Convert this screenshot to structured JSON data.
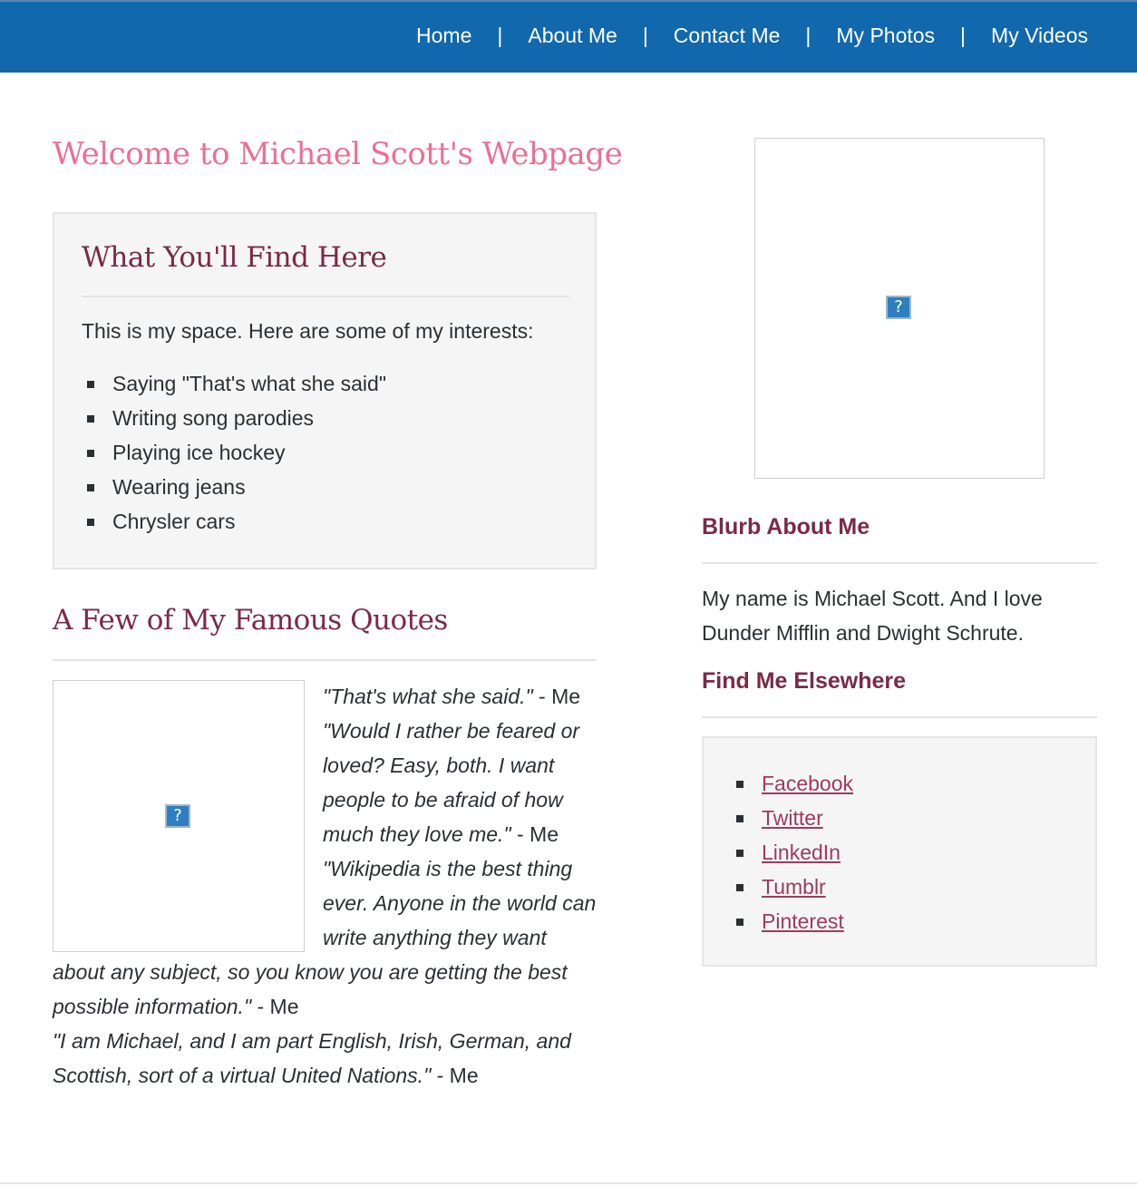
{
  "nav": {
    "items": [
      "Home",
      "About Me",
      "Contact Me",
      "My Photos",
      "My Videos"
    ],
    "separator": "|"
  },
  "page_title": "Welcome to Michael Scott's Webpage",
  "find_here": {
    "heading": "What You'll Find Here",
    "intro": "This is my space. Here are some of my interests:",
    "interests": [
      "Saying \"That's what she said\"",
      "Writing song parodies",
      "Playing ice hockey",
      "Wearing jeans",
      "Chrysler cars"
    ]
  },
  "quotes": {
    "heading": "A Few of My Famous Quotes",
    "items": [
      {
        "text": "\"That's what she said.\"",
        "attribution": " - Me"
      },
      {
        "text": "\"Would I rather be feared or loved? Easy, both. I want people to be afraid of how much they love me.\"",
        "attribution": " - Me"
      },
      {
        "text": "\"Wikipedia is the best thing ever. Anyone in the world can write anything they want about any subject, so you know you are getting the best possible information.\"",
        "attribution": " - Me"
      },
      {
        "text": "\"I am Michael, and I am part English, Irish, German, and Scottish, sort of a virtual United Nations.\"",
        "attribution": " - Me"
      }
    ]
  },
  "broken_image_glyph": "?",
  "blurb": {
    "heading": "Blurb About Me",
    "text": "My name is Michael Scott. And I love Dunder Mifflin and Dwight Schrute."
  },
  "elsewhere": {
    "heading": "Find Me Elsewhere",
    "links": [
      "Facebook",
      "Twitter",
      "LinkedIn",
      "Tumblr",
      "Pinterest"
    ]
  },
  "colors": {
    "nav_bg": "#1168ad",
    "title_pink": "#ec6f92",
    "heading_maroon": "#7b2a46",
    "link": "#a03a5c",
    "box_bg": "#f5f5f5"
  }
}
